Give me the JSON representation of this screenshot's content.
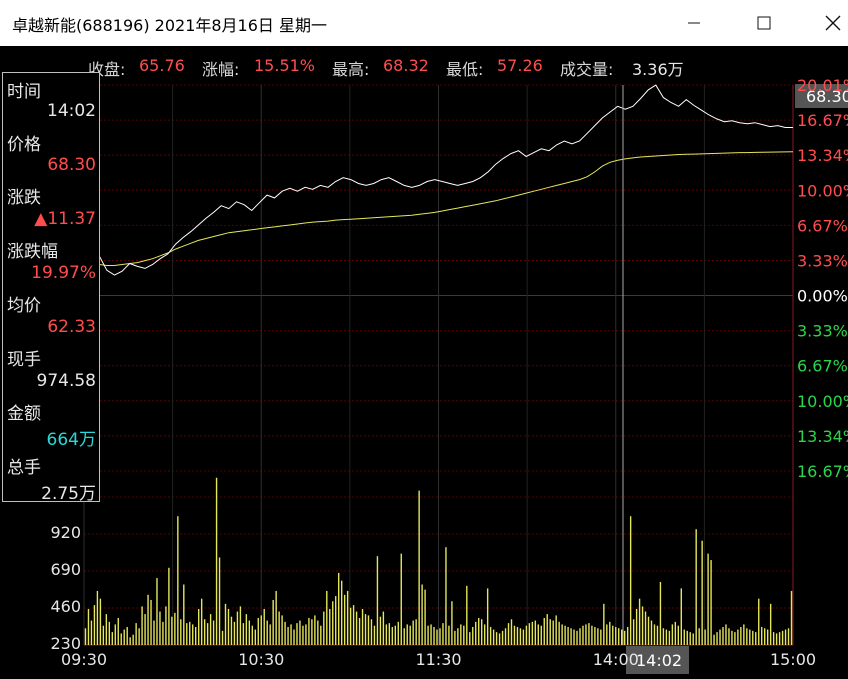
{
  "window": {
    "title": "卓越新能(688196)  2021年8月16日  星期一",
    "minimize_icon": "minimize-icon",
    "maximize_icon": "maximize-icon",
    "close_icon": "close-icon"
  },
  "summary": {
    "close_label": "收盘:",
    "close_value": "65.76",
    "change_label": "涨幅:",
    "change_value": "15.51%",
    "high_label": "最高:",
    "high_value": "68.32",
    "low_label": "最低:",
    "low_value": "57.26",
    "volume_label": "成交量:",
    "volume_value": "3.36万"
  },
  "panel": {
    "time_label": "时间",
    "time_value": "14:02",
    "price_label": "价格",
    "price_value": "68.30",
    "change_label": "涨跌",
    "change_value": "▲11.37",
    "change_pct_label": "涨跌幅",
    "change_pct_value": "19.97%",
    "avg_label": "均价",
    "avg_value": "62.33",
    "last_hand_label": "现手",
    "last_hand_value": "974.58",
    "amount_label": "金额",
    "amount_value": "664万",
    "total_hand_label": "总手",
    "total_hand_value": "2.75万"
  },
  "cursor": {
    "price_tag": "68.30",
    "time_tag": "14:02"
  },
  "colors": {
    "up": "#ff4d4d",
    "down": "#2bd64a",
    "neutral": "#ffffff",
    "price_line": "#ffffff",
    "avg_line": "#e6e65a",
    "volume_bar": "#e6e65a",
    "grid": "#5a0000",
    "cyan": "#29d8d8"
  },
  "chart_data": {
    "type": "line",
    "x_ticks": [
      "09:30",
      "10:30",
      "11:30",
      "14:00",
      "15:00"
    ],
    "right_axis_ticks": [
      "20.01%",
      "16.67%",
      "13.34%",
      "10.00%",
      "6.67%",
      "3.33%",
      "0.00%",
      "3.33%",
      "6.67%",
      "10.00%",
      "13.34%",
      "16.67%"
    ],
    "right_axis_signs": [
      "up",
      "up",
      "up",
      "up",
      "up",
      "up",
      "neutral",
      "down",
      "down",
      "down",
      "down",
      "down"
    ],
    "pct_range": [
      -20.01,
      20.01
    ],
    "volume_ticks": [
      "920",
      "690",
      "460",
      "230"
    ],
    "volume_ylim": [
      0,
      1150
    ],
    "price_pct": [
      3.0,
      1.8,
      2.3,
      0.8,
      0.3,
      0.7,
      1.5,
      1.2,
      1.0,
      1.4,
      2.0,
      2.5,
      3.5,
      4.2,
      4.8,
      5.5,
      6.2,
      6.8,
      7.5,
      7.2,
      7.9,
      7.6,
      7.0,
      7.8,
      8.6,
      8.3,
      9.0,
      9.3,
      9.0,
      9.4,
      9.2,
      9.6,
      9.4,
      10.0,
      10.4,
      10.2,
      9.8,
      9.6,
      9.8,
      10.2,
      10.4,
      10.0,
      9.6,
      9.4,
      9.6,
      10.0,
      10.2,
      10.0,
      9.8,
      9.6,
      9.8,
      10.0,
      10.4,
      11.0,
      11.8,
      12.4,
      12.9,
      13.2,
      12.6,
      13.0,
      13.4,
      13.2,
      13.8,
      14.2,
      13.9,
      14.2,
      15.0,
      15.8,
      16.6,
      17.2,
      17.8,
      17.5,
      17.8,
      18.6,
      19.5,
      20.0,
      18.7,
      18.2,
      17.8,
      18.5,
      17.9,
      17.4,
      16.9,
      16.5,
      16.2,
      16.3,
      16.1,
      16.0,
      16.1,
      15.9,
      15.7,
      15.8,
      15.6,
      15.6
    ],
    "avg_pct": [
      2.0,
      1.6,
      1.4,
      1.3,
      1.3,
      1.4,
      1.5,
      1.6,
      1.8,
      2.0,
      2.3,
      2.6,
      3.0,
      3.3,
      3.6,
      3.9,
      4.1,
      4.3,
      4.5,
      4.7,
      4.8,
      4.9,
      5.0,
      5.1,
      5.2,
      5.3,
      5.4,
      5.5,
      5.6,
      5.7,
      5.8,
      5.85,
      5.9,
      6.0,
      6.05,
      6.1,
      6.15,
      6.2,
      6.25,
      6.3,
      6.35,
      6.4,
      6.45,
      6.5,
      6.6,
      6.7,
      6.8,
      6.95,
      7.1,
      7.25,
      7.4,
      7.55,
      7.7,
      7.85,
      8.0,
      8.2,
      8.4,
      8.6,
      8.8,
      9.0,
      9.2,
      9.4,
      9.6,
      9.8,
      10.0,
      10.2,
      10.5,
      11.0,
      11.6,
      12.0,
      12.2,
      12.35,
      12.45,
      12.55,
      12.6,
      12.65,
      12.7,
      12.75,
      12.8,
      12.82,
      12.85,
      12.87,
      12.9,
      12.92,
      12.95,
      12.97,
      13.0,
      13.0,
      13.02,
      13.04,
      13.05,
      13.06,
      13.07,
      13.08
    ],
    "volume": [
      130,
      280,
      190,
      310,
      420,
      360,
      150,
      240,
      180,
      100,
      160,
      210,
      90,
      120,
      140,
      60,
      80,
      170,
      130,
      300,
      240,
      390,
      350,
      190,
      520,
      260,
      180,
      300,
      160,
      220,
      250,
      190,
      200,
      150,
      170,
      180,
      160,
      140,
      280,
      360,
      200,
      170,
      240,
      190,
      90,
      130,
      110,
      320,
      280,
      220,
      180,
      260,
      300,
      170,
      240,
      190,
      150,
      120,
      210,
      230,
      280,
      190,
      160,
      350,
      420,
      260,
      230,
      180,
      140,
      160,
      120,
      170,
      190,
      150,
      160,
      210,
      200,
      230,
      190,
      150,
      260,
      420,
      280,
      340,
      380,
      560,
      500,
      390,
      420,
      290,
      310,
      260,
      210,
      280,
      240,
      230,
      200,
      150,
      180,
      220,
      260,
      160,
      170,
      140,
      150,
      180,
      170,
      130,
      160,
      150,
      190,
      200,
      220,
      170,
      210,
      150,
      160,
      140,
      120,
      130,
      170,
      190,
      150,
      140,
      110,
      130,
      160,
      150,
      120,
      100,
      140,
      180,
      210,
      200,
      160,
      150,
      140,
      120,
      100,
      90,
      110,
      130,
      170,
      200,
      150,
      140,
      130,
      120,
      150,
      170,
      180,
      190,
      160,
      150,
      210,
      240,
      200,
      190,
      170,
      180,
      160,
      150,
      140,
      130,
      120,
      110,
      130,
      150,
      160,
      170,
      150,
      140,
      130,
      120,
      140,
      160,
      180,
      150,
      140,
      130,
      120,
      110,
      140,
      160,
      200,
      280,
      360,
      300,
      260,
      220,
      190,
      160,
      150,
      140,
      130,
      120,
      110,
      160,
      180,
      150,
      130,
      120,
      110,
      100,
      90,
      110,
      130,
      150,
      120,
      100,
      90,
      80,
      100,
      120,
      140,
      160,
      130,
      110,
      100,
      120,
      140,
      160,
      130,
      120,
      110,
      100,
      120,
      140,
      130,
      120,
      110,
      100,
      90,
      100,
      110,
      120,
      130,
      420
    ],
    "big_bars": {
      "28": 600,
      "31": 1000,
      "33": 470,
      "44": 1300,
      "45": 680,
      "98": 690,
      "106": 710,
      "112": 1200,
      "113": 470,
      "114": 430,
      "121": 760,
      "123": 340,
      "128": 460,
      "135": 440,
      "158": 230,
      "174": 320,
      "183": 1000,
      "193": 490,
      "200": 440,
      "205": 900,
      "207": 810,
      "209": 710,
      "210": 660,
      "226": 360,
      "230": 320,
      "250": 740,
      "251": 740,
      "253": 520,
      "260": 820,
      "262": 330,
      "270": 880
    }
  }
}
